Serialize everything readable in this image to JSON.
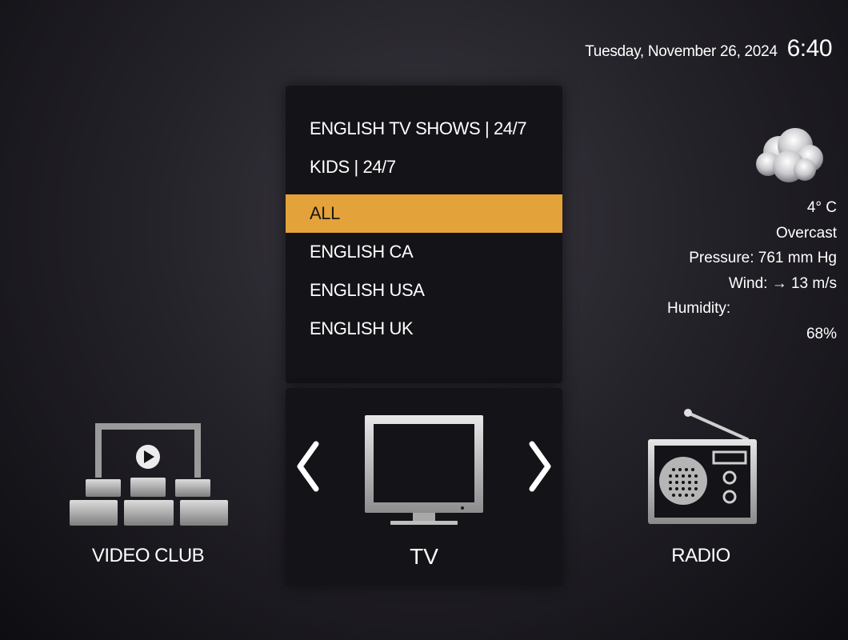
{
  "clock": {
    "date": "Tuesday, November 26, 2024",
    "time": "6:40"
  },
  "weather": {
    "icon": "cloud-icon",
    "temperature": "4° C",
    "condition": "Overcast",
    "pressure": "Pressure: 761 mm Hg",
    "wind": "Wind: → 13 m/s",
    "humidity_label": "Humidity:",
    "humidity_value": "68%"
  },
  "categories": {
    "items": [
      {
        "label": "ENGLISH TV SHOWS | 24/7"
      },
      {
        "label": "KIDS | 24/7"
      },
      {
        "label": "ALL"
      },
      {
        "label": "ENGLISH CA"
      },
      {
        "label": "ENGLISH USA"
      },
      {
        "label": "ENGLISH UK"
      }
    ],
    "selected_index": 2
  },
  "menu": {
    "left": {
      "label": "VIDEO CLUB",
      "icon": "video-club-icon"
    },
    "center": {
      "label": "TV",
      "icon": "tv-icon"
    },
    "right": {
      "label": "RADIO",
      "icon": "radio-icon"
    }
  },
  "colors": {
    "accent": "#e4a23a",
    "panel": "#141317"
  }
}
